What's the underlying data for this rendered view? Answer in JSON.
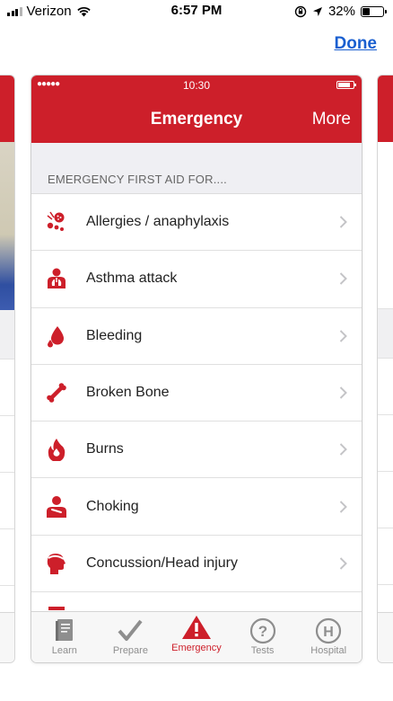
{
  "status_bar": {
    "carrier": "Verizon",
    "time": "6:57 PM",
    "battery": "32%"
  },
  "done_label": "Done",
  "app": {
    "mini_time": "10:30",
    "title": "Emergency",
    "more_label": "More",
    "section_header": "EMERGENCY FIRST AID FOR....",
    "items": [
      {
        "label": "Allergies / anaphylaxis",
        "icon": "allergy-icon"
      },
      {
        "label": "Asthma attack",
        "icon": "asthma-icon"
      },
      {
        "label": "Bleeding",
        "icon": "blood-drop-icon"
      },
      {
        "label": "Broken Bone",
        "icon": "bone-icon"
      },
      {
        "label": "Burns",
        "icon": "flame-icon"
      },
      {
        "label": "Choking",
        "icon": "choking-icon"
      },
      {
        "label": "Concussion/Head injury",
        "icon": "head-injury-icon"
      }
    ],
    "tabs": [
      {
        "label": "Learn",
        "icon": "book-icon"
      },
      {
        "label": "Prepare",
        "icon": "checkmark-icon"
      },
      {
        "label": "Emergency",
        "icon": "warning-icon"
      },
      {
        "label": "Tests",
        "icon": "question-icon"
      },
      {
        "label": "Hospital",
        "icon": "hospital-icon"
      }
    ],
    "active_tab": "Emergency"
  },
  "colors": {
    "brand_red": "#cd1f2a",
    "link_blue": "#1a5fd0",
    "inactive_tab": "#8e8e8e"
  }
}
